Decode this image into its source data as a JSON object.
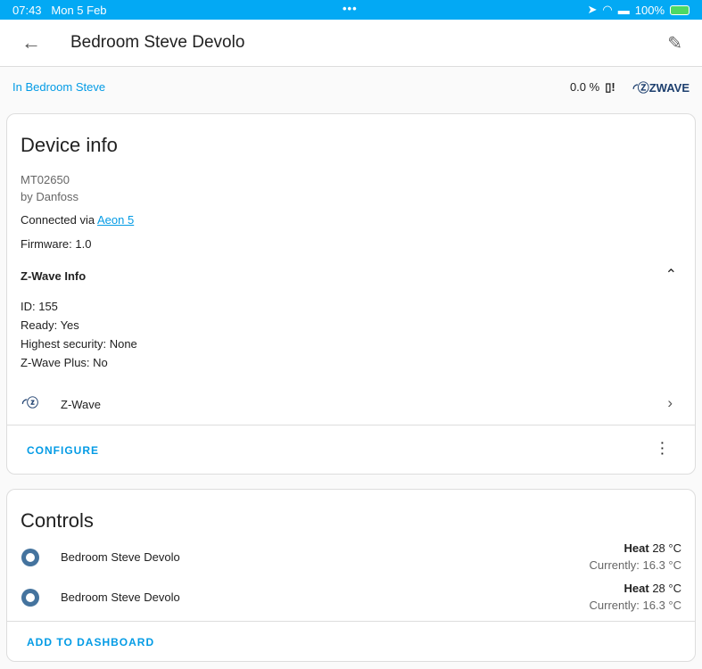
{
  "status": {
    "time": "07:43",
    "date": "Mon 5 Feb",
    "battery": "100%"
  },
  "header": {
    "title": "Bedroom Steve Devolo"
  },
  "sub": {
    "area_link": "In Bedroom Steve",
    "battery_level": "0.0 %",
    "logo": "ZWAVE"
  },
  "device_info": {
    "heading": "Device info",
    "model": "MT02650",
    "manufacturer": "by Danfoss",
    "connected_prefix": "Connected via ",
    "connected_link": "Aeon 5",
    "firmware": "Firmware: 1.0",
    "zwave_heading": "Z-Wave Info",
    "id": "ID: 155",
    "ready": "Ready: Yes",
    "security": "Highest security: None",
    "plus": "Z-Wave Plus: No",
    "integration": "Z-Wave",
    "configure": "CONFIGURE"
  },
  "controls": {
    "heading": "Controls",
    "items": [
      {
        "name": "Bedroom Steve Devolo",
        "mode": "Heat",
        "target": " 28 °C",
        "current": "Currently: 16.3 °C"
      },
      {
        "name": "Bedroom Steve Devolo",
        "mode": "Heat",
        "target": " 28 °C",
        "current": "Currently: 16.3 °C"
      }
    ],
    "add": "ADD TO DASHBOARD"
  }
}
